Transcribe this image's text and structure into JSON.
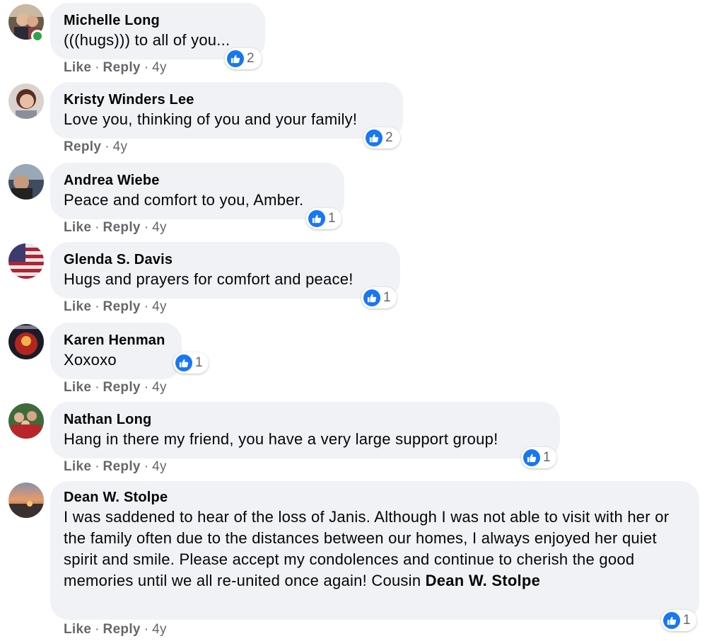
{
  "comments": [
    {
      "author": "Michelle Long",
      "text": "(((hugs))) to all of you...",
      "reactions": "2",
      "like_label": "Like",
      "reply_label": "Reply",
      "time": "4y",
      "online": true
    },
    {
      "author": "Kristy Winders Lee",
      "text": "Love you, thinking of you and your family!",
      "reactions": "2",
      "reply_label": "Reply",
      "time": "4y"
    },
    {
      "author": "Andrea Wiebe",
      "text": "Peace and comfort to you, Amber.",
      "reactions": "1",
      "like_label": "Like",
      "reply_label": "Reply",
      "time": "4y"
    },
    {
      "author": "Glenda S. Davis",
      "text": "Hugs and prayers for comfort and peace!",
      "reactions": "1",
      "like_label": "Like",
      "reply_label": "Reply",
      "time": "4y"
    },
    {
      "author": "Karen Henman",
      "text": "Xoxoxo",
      "reactions": "1",
      "like_label": "Like",
      "reply_label": "Reply",
      "time": "4y"
    },
    {
      "author": "Nathan Long",
      "text": "Hang in there my friend, you have a very large support group!",
      "reactions": "1",
      "like_label": "Like",
      "reply_label": "Reply",
      "time": "4y"
    },
    {
      "author": "Dean W. Stolpe",
      "text": "I was saddened to hear of the loss of Janis. Although I was not able to visit with her or the family often due to the distances between our homes, I always enjoyed her quiet spirit and smile. Please accept my condolences and continue to cherish the good memories until we all re-united once again! Cousin ",
      "text_bold": "Dean W. Stolpe",
      "reactions": "1",
      "like_label": "Like",
      "reply_label": "Reply",
      "time": "4y"
    }
  ],
  "separator": "·",
  "colors": {
    "bubble": "#f0f2f5",
    "like_blue": "#1877f2",
    "meta_gray": "#65676b",
    "online_green": "#31a24c"
  }
}
